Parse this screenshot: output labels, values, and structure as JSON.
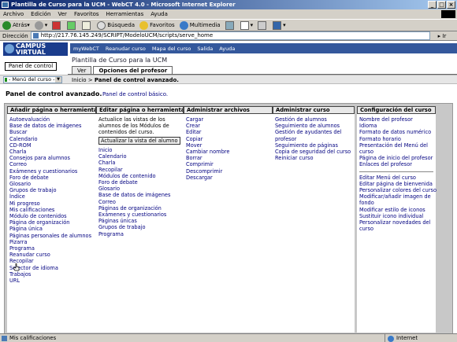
{
  "window": {
    "title": "Plantilla de Curso para la UCM - WebCT 4.0 - Microsoft Internet Explorer"
  },
  "menubar": [
    "Archivo",
    "Edición",
    "Ver",
    "Favoritos",
    "Herramientas",
    "Ayuda"
  ],
  "toolbar": {
    "back": "Atrás",
    "search": "Búsqueda",
    "favorites": "Favoritos",
    "media": "Multimedia"
  },
  "address": {
    "label": "Dirección",
    "url": "http://217.76.145.249/SCRIPT/ModeloUCM/scripts/serve_home",
    "go": "Ir"
  },
  "site": {
    "logo": "CAMPUS VIRTUAL",
    "nav": [
      "myWebCT",
      "Reanudar curso",
      "Mapa del curso",
      "Salida",
      "Ayuda"
    ],
    "panel_button": "Panel de control",
    "course_title": "Plantilla de Curso para la UCM",
    "tabs": [
      "Ver",
      "Opciones del profesor"
    ],
    "course_menu": "- Menú del curso -",
    "breadcrumb_home": "Inicio",
    "breadcrumb_sep": " > ",
    "breadcrumb_current": "Panel de control avanzado.",
    "page_title": "Panel de control avanzado.",
    "alt_link": "Panel de control básico."
  },
  "columns": {
    "add": {
      "header": "Añadir página o herramienta",
      "items": [
        "Autoevaluación",
        "Base de datos de imágenes",
        "Buscar",
        "Calendario",
        "CD-ROM",
        "Charla",
        "Consejos para alumnos",
        "Correo",
        "Exámenes y cuestionarios",
        "Foro de debate",
        "Glosario",
        "Grupos de trabajo",
        "Índice",
        "Mi progreso",
        "Mis calificaciones",
        "Módulo de contenidos",
        "Página de organización",
        "Página única",
        "Páginas personales de alumnos",
        "Pizarra",
        "Programa",
        "Reanudar curso",
        "Recopilar",
        "Selector de idioma",
        "Trabajos",
        "URL"
      ]
    },
    "edit": {
      "header": "Editar página o herramienta",
      "desc": "Actualice las vistas de los alumnos de los Módulos de contenidos del curso.",
      "button": "Actualizar la vista del alumno",
      "items": [
        "Inicio",
        "Calendario",
        "Charla",
        "Recopilar",
        "Módulos de contenido",
        "Foro de debate",
        "Glosario",
        "Base de datos de imágenes",
        "Correo",
        "Páginas de organización",
        "Exámenes y cuestionarios",
        "Páginas únicas",
        "Grupos de trabajo",
        "Programa"
      ]
    },
    "files": {
      "header": "Administrar archivos",
      "items": [
        "Cargar",
        "Crear",
        "Editar",
        "Copiar",
        "Mover",
        "Cambiar nombre",
        "Borrar",
        "Comprimir",
        "Descomprimir",
        "Descargar"
      ]
    },
    "course": {
      "header": "Administrar curso",
      "items": [
        "Gestión de alumnos",
        "Seguimiento de alumnos",
        "Gestión de ayudantes del profesor",
        "Seguimiento de páginas",
        "Copia de seguridad del curso",
        "Reiniciar curso"
      ]
    },
    "config": {
      "header": "Configuración del curso",
      "items": [
        "Nombre del profesor",
        "Idioma",
        "Formato de datos numérico",
        "Formato horario",
        "Presentación del Menú del curso",
        "Página de inicio del profesor",
        "Enlaces del profesor"
      ],
      "items2": [
        "Editar Menú del curso",
        "Editar página de bienvenida",
        "Personalizar colores del curso",
        "Modificar/añadir imagen de fondo",
        "Modificar estilo de iconos",
        "Sustituir icono individual",
        "Personalizar novedades del curso"
      ]
    }
  },
  "status": {
    "text": "Mis calificaciones",
    "zone": "Internet"
  }
}
